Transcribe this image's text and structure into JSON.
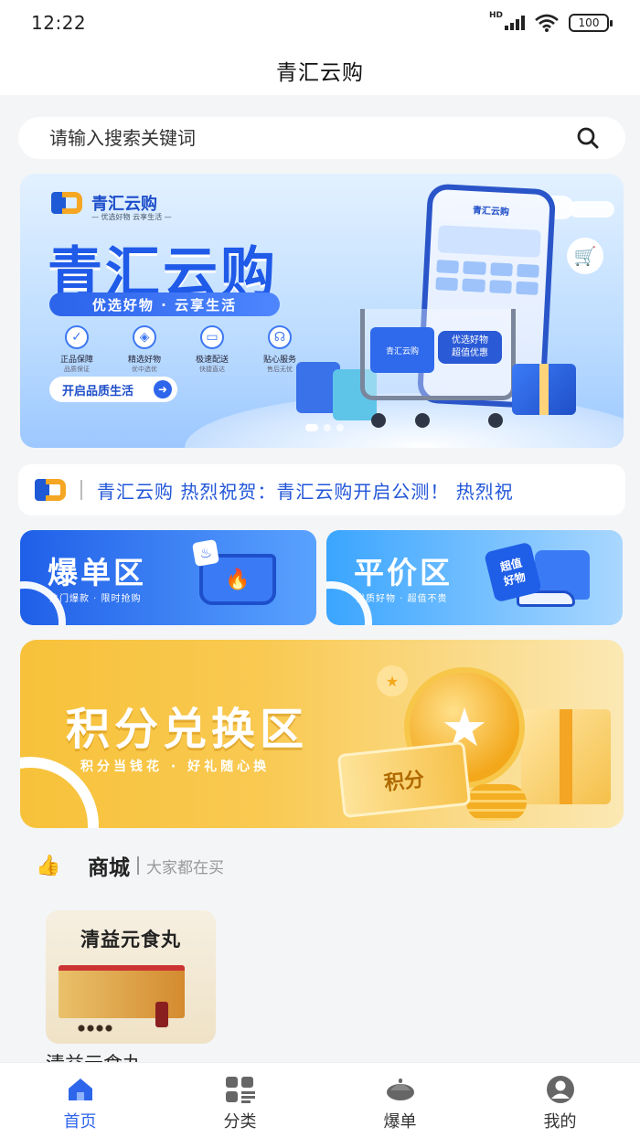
{
  "status_bar": {
    "time": "12:22",
    "network": "HD",
    "battery": "100"
  },
  "header": {
    "title": "青汇云购"
  },
  "search": {
    "placeholder": "请输入搜索关键词",
    "icon": "search-icon"
  },
  "banner": {
    "brand_name": "青汇云购",
    "brand_tagline": "— 优选好物  云享生活 —",
    "title": "青汇云购",
    "slogan": "优选好物 · 云享生活",
    "features": [
      {
        "icon": "shield-icon",
        "title": "正品保障",
        "subtitle": "品质保证"
      },
      {
        "icon": "tag-icon",
        "title": "精选好物",
        "subtitle": "优中选优"
      },
      {
        "icon": "truck-icon",
        "title": "极速配送",
        "subtitle": "快捷直达"
      },
      {
        "icon": "headset-icon",
        "title": "贴心服务",
        "subtitle": "售后无忧"
      }
    ],
    "cta_label": "开启品质生活",
    "phone_title": "青汇云购",
    "cart_box_label": "青汇云购",
    "cart_tag_line1": "优选好物",
    "cart_tag_line2": "超值优惠",
    "carousel_count": 3,
    "carousel_active": 0
  },
  "notice": {
    "text": "青汇云购  热烈祝贺：青汇云购开启公测！  热烈祝"
  },
  "zones": [
    {
      "title": "爆单区",
      "subtitle": "热门爆款 · 限时抢购"
    },
    {
      "title": "平价区",
      "subtitle": "优质好物 · 超值不贵",
      "tag_line1": "超值",
      "tag_line2": "好物"
    }
  ],
  "points_zone": {
    "title": "积分兑换区",
    "subtitle": "积分当钱花 · 好礼随心换",
    "ticket_label": "积分"
  },
  "section": {
    "title": "商城",
    "subtitle": "大家都在买"
  },
  "products": [
    {
      "image_caption": "清益元食丸",
      "name": "清益元食丸"
    }
  ],
  "tabbar": {
    "items": [
      {
        "label": "首页",
        "icon": "home-icon",
        "active": true
      },
      {
        "label": "分类",
        "icon": "category-icon",
        "active": false
      },
      {
        "label": "爆单",
        "icon": "hot-icon",
        "active": false
      },
      {
        "label": "我的",
        "icon": "user-icon",
        "active": false
      }
    ]
  },
  "colors": {
    "accent": "#2d66ea",
    "background": "#f4f5f7",
    "points_gold": "#f7c23a"
  }
}
